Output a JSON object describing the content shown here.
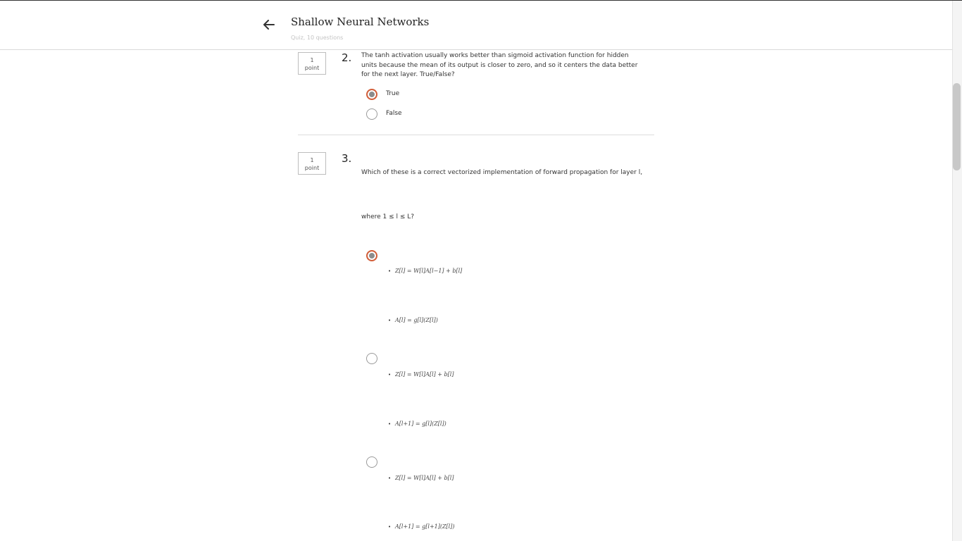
{
  "header": {
    "title": "Shallow Neural Networks",
    "subtitle": "Quiz, 10 questions"
  },
  "questions": [
    {
      "number": "2.",
      "points_value": "1",
      "points_label": "point",
      "text": "The tanh activation usually works better than sigmoid activation function for hidden units because the mean of its output is closer to zero, and so it centers the data better for the next layer. True/False?",
      "options": [
        {
          "label": "True",
          "selected": true
        },
        {
          "label": "False",
          "selected": false
        }
      ]
    },
    {
      "number": "3.",
      "points_value": "1",
      "points_label": "point",
      "text": "Which of these is a correct vectorized implementation of forward propagation for layer l,",
      "text2": "where 1 ≤ l ≤ L?",
      "options": [
        {
          "selected": true,
          "line1": "Z[l] = W[l]A[l−1] + b[l]",
          "line2": "A[l] = g[l](Z[l])"
        },
        {
          "selected": false,
          "line1": "Z[l] = W[l]A[l] + b[l]",
          "line2": "A[l+1] = g[l](Z[l])"
        },
        {
          "selected": false,
          "line1": "Z[l] = W[l]A[l] + b[l]",
          "line2": "A[l+1] = g[l+1](Z[l])"
        }
      ]
    }
  ],
  "icons": {
    "back": "arrow-left-icon",
    "bullet": "•"
  },
  "colors": {
    "radio_selected_ring": "#d35f3a",
    "radio_selected_fill": "#8c8c8c"
  }
}
